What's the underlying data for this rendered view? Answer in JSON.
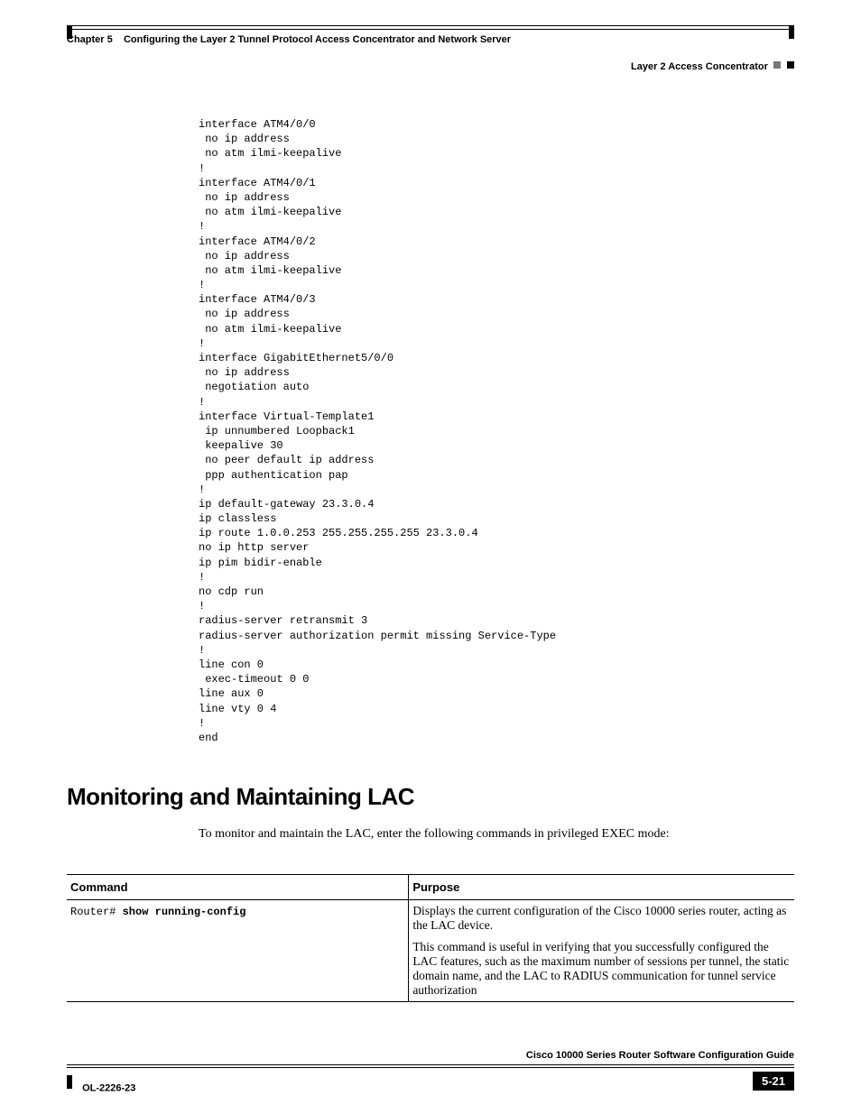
{
  "header": {
    "chapter": "Chapter 5",
    "chapter_title": "Configuring the Layer 2 Tunnel Protocol Access Concentrator and Network Server",
    "section": "Layer 2 Access Concentrator"
  },
  "code": "interface ATM4/0/0\n no ip address\n no atm ilmi-keepalive\n!\ninterface ATM4/0/1\n no ip address\n no atm ilmi-keepalive\n!\ninterface ATM4/0/2\n no ip address\n no atm ilmi-keepalive\n!\ninterface ATM4/0/3\n no ip address\n no atm ilmi-keepalive\n!\ninterface GigabitEthernet5/0/0\n no ip address\n negotiation auto\n!\ninterface Virtual-Template1\n ip unnumbered Loopback1\n keepalive 30\n no peer default ip address\n ppp authentication pap\n!\nip default-gateway 23.3.0.4\nip classless\nip route 1.0.0.253 255.255.255.255 23.3.0.4\nno ip http server\nip pim bidir-enable\n!\nno cdp run\n!\nradius-server retransmit 3\nradius-server authorization permit missing Service-Type\n!\nline con 0\n exec-timeout 0 0\nline aux 0\nline vty 0 4\n!\nend",
  "heading": "Monitoring and Maintaining LAC",
  "intro": "To monitor and maintain the LAC, enter the following commands in privileged EXEC mode:",
  "table": {
    "headers": {
      "command": "Command",
      "purpose": "Purpose"
    },
    "rows": [
      {
        "command_prefix": "Router# ",
        "command_bold": "show running-config",
        "purpose": [
          "Displays the current configuration of the Cisco 10000 series router, acting as the LAC device.",
          "This command is useful in verifying that you successfully configured the LAC features, such as the maximum number of sessions per tunnel, the static domain name, and the LAC to RADIUS communication for tunnel service authorization"
        ]
      }
    ]
  },
  "footer": {
    "book_title": "Cisco 10000 Series Router Software Configuration Guide",
    "doc_id": "OL-2226-23",
    "page_number": "5-21"
  }
}
